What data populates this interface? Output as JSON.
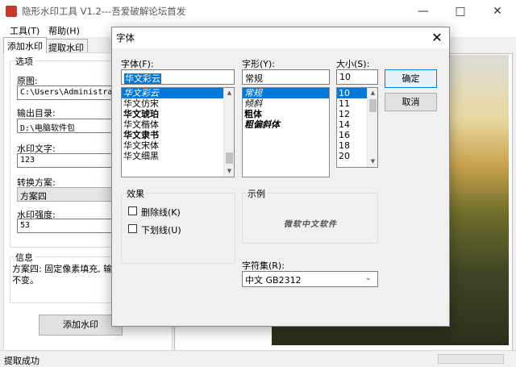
{
  "app": {
    "title": "隐形水印工具 V1.2---吾爱破解论坛首发",
    "menu": [
      "工具(T)",
      "帮助(H)"
    ],
    "tabs": [
      "添加水印",
      "提取水印"
    ],
    "options_group": "选项",
    "original_label": "原图:",
    "original_value": "C:\\Users\\Administrator\\",
    "output_label": "输出目录:",
    "output_value": "D:\\电脑软件包",
    "watermark_label": "水印文字:",
    "watermark_value": "123",
    "scheme_label": "转换方案:",
    "scheme_value": "方案四",
    "strength_label": "水印强度:",
    "strength_value": "53",
    "info_group": "信息",
    "info_text_1": "方案四: 固定像素填充, 输",
    "info_text_2": "不变。",
    "add_button": "添加水印",
    "status": "提取成功"
  },
  "dialog": {
    "title": "字体",
    "font_label": "字体(F):",
    "font_value": "华文彩云",
    "font_list": [
      "华文彩云",
      "华文仿宋",
      "华文琥珀",
      "华文楷体",
      "华文隶书",
      "华文宋体",
      "华文细黑"
    ],
    "style_label": "字形(Y):",
    "style_value": "常规",
    "style_list": [
      "常规",
      "倾斜",
      "粗体",
      "粗偏斜体"
    ],
    "size_label": "大小(S):",
    "size_value": "10",
    "size_list": [
      "10",
      "11",
      "12",
      "14",
      "16",
      "18",
      "20"
    ],
    "ok_button": "确定",
    "cancel_button": "取消",
    "effects_group": "效果",
    "strikeout_label": "删除线(K)",
    "underline_label": "下划线(U)",
    "sample_group": "示例",
    "sample_text": "微软中文软件",
    "charset_label": "字符集(R):",
    "charset_value": "中文 GB2312"
  },
  "colors": {
    "selection": "#0078d7",
    "window_bg": "#f0f0f0"
  }
}
